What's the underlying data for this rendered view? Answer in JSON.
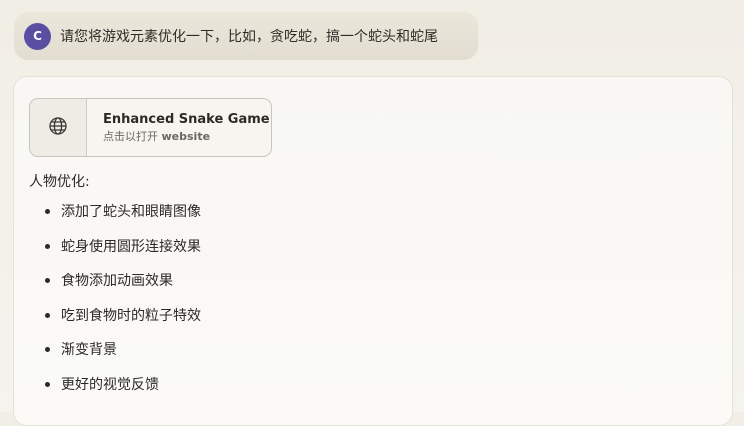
{
  "user_message": {
    "avatar_initial": "C",
    "avatar_color": "#5a4ea3",
    "text": "请您将游戏元素优化一下，比如，贪吃蛇，搞一个蛇头和蛇尾"
  },
  "artifact": {
    "icon": "globe-icon",
    "title": "Enhanced Snake Game",
    "subtitle_prefix": "点击以打开",
    "subtitle_kind": "website"
  },
  "response": {
    "heading": "人物优化:",
    "bullets": [
      "添加了蛇头和眼睛图像",
      "蛇身使用圆形连接效果",
      "食物添加动画效果",
      "吃到食物时的粒子特效",
      "渐变背景",
      "更好的视觉反馈"
    ]
  }
}
